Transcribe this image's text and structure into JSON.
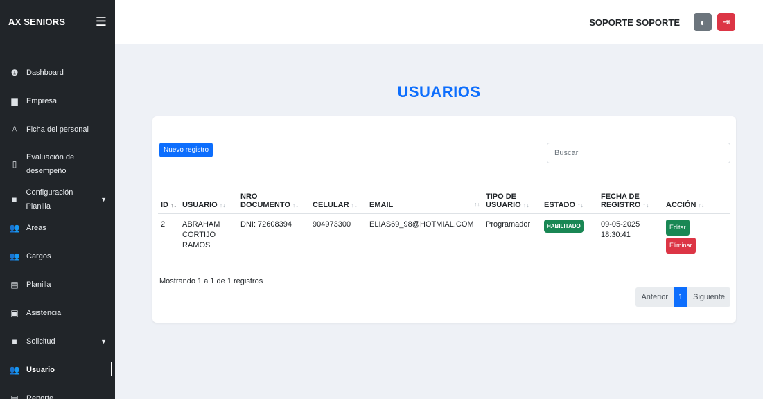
{
  "sidebar": {
    "brand": "AX SENIORS",
    "items": [
      {
        "label": "Dashboard",
        "icon": "info-circle-icon",
        "glyph": "❶"
      },
      {
        "label": "Empresa",
        "icon": "building-icon",
        "glyph": "▆"
      },
      {
        "label": "Ficha del personal",
        "icon": "person-icon",
        "glyph": "♙"
      },
      {
        "label": "Evaluación de desempeño",
        "icon": "clipboard-icon",
        "glyph": "▯"
      },
      {
        "label": "Configuración Planilla",
        "icon": "folder-icon",
        "glyph": "■"
      },
      {
        "label": "Areas",
        "icon": "users-icon",
        "glyph": "👥"
      },
      {
        "label": "Cargos",
        "icon": "users-icon",
        "glyph": "👥"
      },
      {
        "label": "Planilla",
        "icon": "file-icon",
        "glyph": "▤"
      },
      {
        "label": "Asistencia",
        "icon": "badge-icon",
        "glyph": "▣"
      },
      {
        "label": "Solicitud",
        "icon": "folder-icon",
        "glyph": "■"
      },
      {
        "label": "Usuario",
        "icon": "users-icon",
        "glyph": "👥"
      },
      {
        "label": "Reporte",
        "icon": "file-icon",
        "glyph": "▤"
      }
    ]
  },
  "topbar": {
    "user": "SOPORTE SOPORTE",
    "theme_icon": "◐",
    "logout_icon": "⇥"
  },
  "page": {
    "title": "USUARIOS",
    "new_button": "Nuevo registro",
    "search_placeholder": "Buscar"
  },
  "table": {
    "headers": {
      "id": "ID",
      "usuario": "USUARIO",
      "nro1": "NRO",
      "nro2": "DOCUMENTO",
      "celular": "CELULAR",
      "email": "EMAIL",
      "tipo1": "TIPO DE",
      "tipo2": "USUARIO",
      "estado": "ESTADO",
      "fecha1": "FECHA DE",
      "fecha2": "REGISTRO",
      "accion": "ACCIÓN"
    },
    "rows": [
      {
        "id": "2",
        "usuario1": "ABRAHAM",
        "usuario2": "CORTIJO",
        "usuario3": "RAMOS",
        "documento": "DNI: 72608394",
        "celular": "904973300",
        "email": "ELIAS69_98@HOTMIAL.COM",
        "tipo": "Programador",
        "estado": "HABILITADO",
        "fecha1": "09-05-2025",
        "fecha2": "18:30:41",
        "edit": "Editar",
        "delete": "Eliminar"
      }
    ]
  },
  "footer": {
    "info": "Mostrando 1 a 1 de 1 registros",
    "prev": "Anterior",
    "page": "1",
    "next": "Siguiente"
  },
  "colors": {
    "accent": "#0d6efd",
    "sidebar": "#212529",
    "success": "#198754",
    "danger": "#dc3545"
  }
}
